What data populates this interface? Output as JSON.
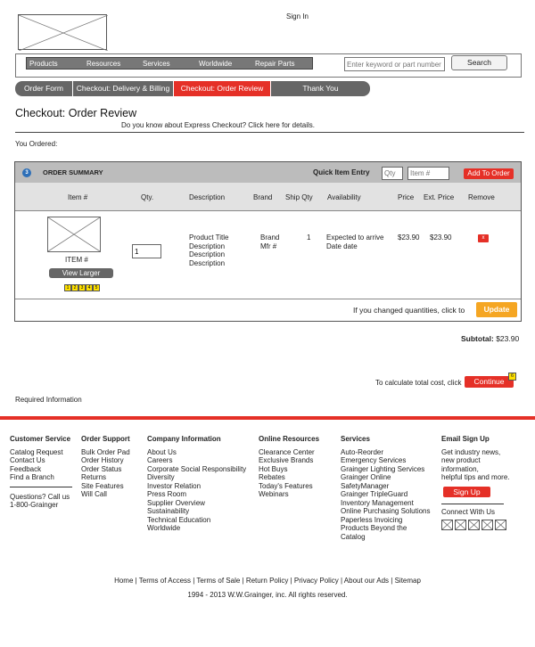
{
  "header": {
    "signin_label": "Sign In"
  },
  "nav": {
    "items": [
      "Products",
      "Resources",
      "Services",
      "Worldwide",
      "Repair Parts"
    ]
  },
  "search": {
    "placeholder": "Enter keyword or part number",
    "button_label": "Search"
  },
  "steps": [
    {
      "label": "Order Form",
      "active": false
    },
    {
      "label": "Checkout: Delivery & Billing",
      "active": false
    },
    {
      "label": "Checkout: Order Review",
      "active": true
    },
    {
      "label": "Thank You",
      "active": false
    }
  ],
  "page": {
    "title": "Checkout: Order Review",
    "express_note": "Do you know about Express Checkout? Click here for details.",
    "you_ordered": "You Ordered:"
  },
  "summary": {
    "number": "3",
    "title": "ORDER SUMMARY",
    "quick_entry_label": "Quick Item Entry",
    "qty_placeholder": "Qty",
    "item_placeholder": "Item #",
    "add_button": "Add To Order",
    "columns": {
      "item": "Item #",
      "qty": "Qty.",
      "description": "Description",
      "brand": "Brand",
      "ship_qty": "Ship Qty",
      "availability": "Availability",
      "price": "Price",
      "ext_price": "Ext. Price",
      "remove": "Remove"
    },
    "row": {
      "item_label": "ITEM #",
      "view_larger": "View Larger",
      "rating_boxes": [
        "1",
        "2",
        "3",
        "4",
        "5"
      ],
      "qty": "1",
      "description_lines": [
        "Product Title",
        "Description",
        "Description",
        "Description"
      ],
      "brand_lines": [
        "Brand",
        "Mfr #"
      ],
      "ship_qty": "1",
      "availability": "Expected to arrive Date date",
      "price": "$23.90",
      "ext_price": "$23.90",
      "remove_label": "x"
    },
    "changed_text": "If you changed quantities, click to",
    "update_button": "Update"
  },
  "totals": {
    "subtotal_label": "Subtotal:",
    "subtotal_value": "$23.90",
    "calc_text": "To calculate total cost, click",
    "continue_button": "Continue",
    "badge": "6",
    "required": "Required Information"
  },
  "footer": {
    "customer_service": {
      "heading": "Customer Service",
      "links": [
        "Catalog Request",
        "Contact Us",
        "Feedback",
        "Find a Branch"
      ],
      "question": "Questions? Call us",
      "phone": "1-800-Grainger"
    },
    "order_support": {
      "heading": "Order Support",
      "links": [
        "Bulk Order Pad",
        "Order History",
        "Order Status",
        "Returns",
        "Site Features",
        "Will Call"
      ]
    },
    "company_info": {
      "heading": "Company Information",
      "links": [
        "About Us",
        "Careers",
        "Corporate Social Responsibility",
        "Diversity",
        "Investor Relation",
        "Press Room",
        "Supplier Overview",
        "Sustainability",
        "Technical Education",
        "Worldwide"
      ]
    },
    "online_resources": {
      "heading": "Online Resources",
      "links": [
        "Clearance Center",
        "Exclusive Brands",
        "Hot Buys",
        "Rebates",
        "Today's Features",
        "Webinars"
      ]
    },
    "services": {
      "heading": "Services",
      "links": [
        "Auto-Reorder",
        "Emergency Services",
        "Grainger Lighting Services",
        "Grainger Online",
        "SafetyManager",
        "Grainger TripleGuard",
        "Inventory Management",
        "Online Purchasing Solutions",
        "Paperless Invoicing",
        "Products Beyond the Catalog"
      ]
    },
    "email_signup": {
      "heading": "Email Sign Up",
      "text_lines": [
        "Get industry news,",
        "new product",
        "information,",
        "helpful tips and more."
      ],
      "button": "Sign Up",
      "connect": "Connect With Us"
    },
    "legal": "Home | Terms of Access | Terms of Sale | Return Policy | Privacy Policy | About our Ads | Sitemap",
    "copyright": "1994 - 2013 W.W.Grainger, inc. All rights reserved."
  }
}
